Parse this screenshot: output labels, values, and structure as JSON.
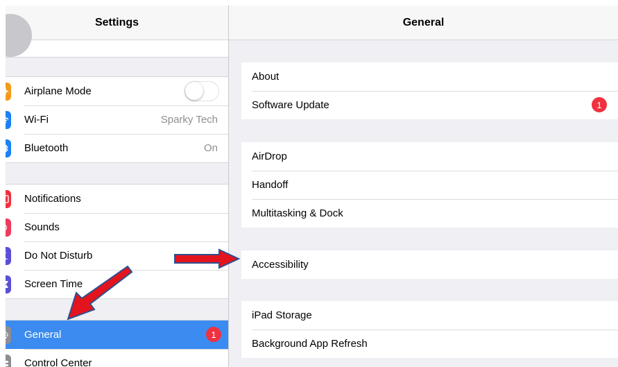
{
  "left_pane": {
    "title": "Settings",
    "group_connectivity": [
      {
        "label": "Airplane Mode",
        "value": "",
        "icon": "airplane-icon",
        "toggle": "off"
      },
      {
        "label": "Wi-Fi",
        "value": "Sparky Tech",
        "icon": "wifi-icon"
      },
      {
        "label": "Bluetooth",
        "value": "On",
        "icon": "bluetooth-icon"
      }
    ],
    "group_notifications": [
      {
        "label": "Notifications",
        "icon": "notifications-icon"
      },
      {
        "label": "Sounds",
        "icon": "sounds-icon"
      },
      {
        "label": "Do Not Disturb",
        "icon": "moon-icon"
      },
      {
        "label": "Screen Time",
        "icon": "hourglass-icon"
      }
    ],
    "group_general": [
      {
        "label": "General",
        "badge": "1",
        "icon": "gear-icon",
        "selected": true
      },
      {
        "label": "Control Center",
        "icon": "control-center-icon"
      }
    ]
  },
  "right_pane": {
    "title": "General",
    "group_about": [
      {
        "label": "About"
      },
      {
        "label": "Software Update",
        "badge": "1"
      }
    ],
    "group_airdrop": [
      {
        "label": "AirDrop"
      },
      {
        "label": "Handoff"
      },
      {
        "label": "Multitasking & Dock"
      }
    ],
    "group_accessibility": [
      {
        "label": "Accessibility"
      }
    ],
    "group_storage": [
      {
        "label": "iPad Storage"
      },
      {
        "label": "Background App Refresh"
      }
    ]
  },
  "colors": {
    "selected_row": "#3b8bf0",
    "badge": "#f0313f",
    "annotation_arrow": "#e3141d",
    "annotation_arrow_outline": "#2f4f8f",
    "group_background": "#efeff4"
  }
}
